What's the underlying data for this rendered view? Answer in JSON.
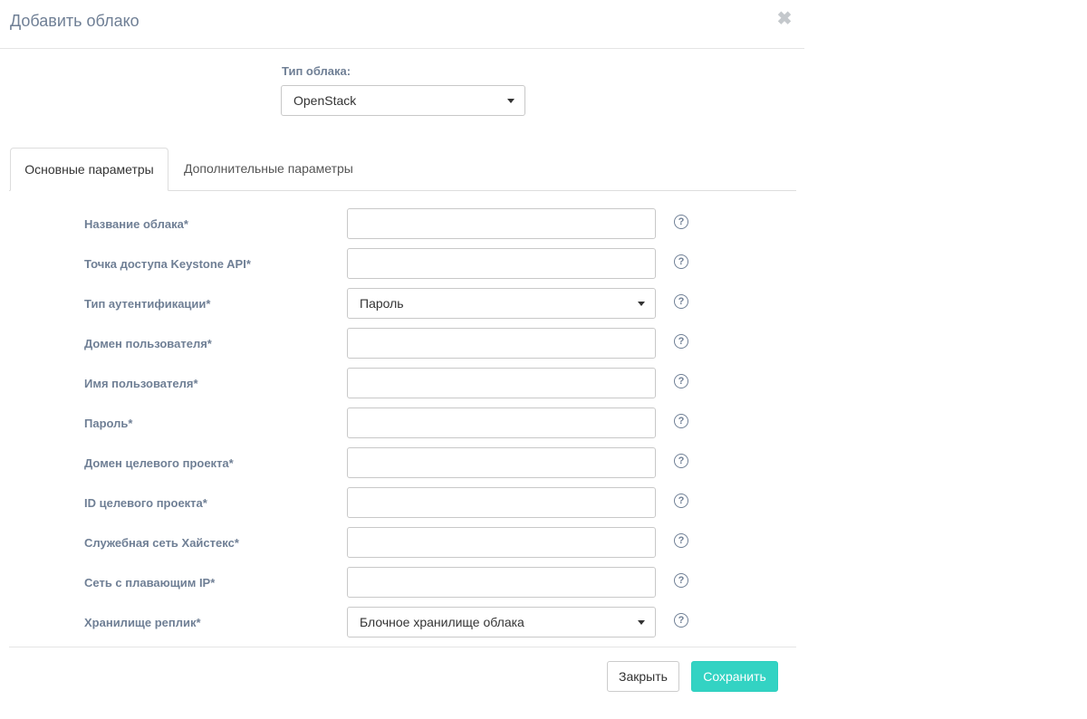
{
  "dialog": {
    "title": "Добавить облако",
    "close_icon": "close-icon"
  },
  "cloud_type": {
    "label": "Тип облака:",
    "value": "OpenStack"
  },
  "tabs": [
    {
      "label": "Основные параметры",
      "active": true
    },
    {
      "label": "Дополнительные параметры",
      "active": false
    }
  ],
  "fields": [
    {
      "label": "Название облака*",
      "type": "text",
      "value": ""
    },
    {
      "label": "Точка доступа Keystone API*",
      "type": "text",
      "value": ""
    },
    {
      "label": "Тип аутентификации*",
      "type": "select",
      "value": "Пароль"
    },
    {
      "label": "Домен пользователя*",
      "type": "text",
      "value": ""
    },
    {
      "label": "Имя пользователя*",
      "type": "text",
      "value": ""
    },
    {
      "label": "Пароль*",
      "type": "text",
      "value": ""
    },
    {
      "label": "Домен целевого проекта*",
      "type": "text",
      "value": ""
    },
    {
      "label": "ID целевого проекта*",
      "type": "text",
      "value": ""
    },
    {
      "label": "Служебная сеть Хайстекс*",
      "type": "text",
      "value": ""
    },
    {
      "label": "Сеть с плавающим IP*",
      "type": "text",
      "value": ""
    },
    {
      "label": "Хранилище реплик*",
      "type": "select",
      "value": "Блочное хранилище облака"
    }
  ],
  "help_icon": "?",
  "footer": {
    "close_label": "Закрыть",
    "save_label": "Сохранить"
  },
  "colors": {
    "accent": "#33d3c3",
    "label": "#6f7f95"
  }
}
